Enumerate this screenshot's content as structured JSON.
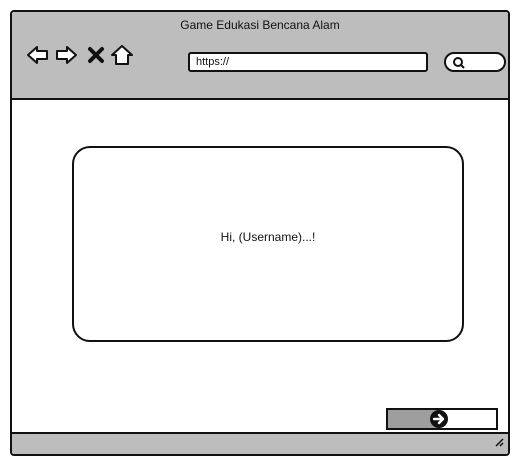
{
  "window": {
    "title": "Game Edukasi Bencana Alam"
  },
  "toolbar": {
    "icons": [
      "back-arrow-icon",
      "forward-arrow-icon",
      "close-icon",
      "home-icon"
    ],
    "url": "https://",
    "search_icon": "search-icon"
  },
  "dialog": {
    "greeting": "Hi, (Username)...!"
  },
  "next_button": {
    "icon": "arrow-right-circle-icon"
  },
  "colors": {
    "chrome": "#bdbdbd",
    "outline": "#111111",
    "button_fill": "#9e9e9e"
  }
}
